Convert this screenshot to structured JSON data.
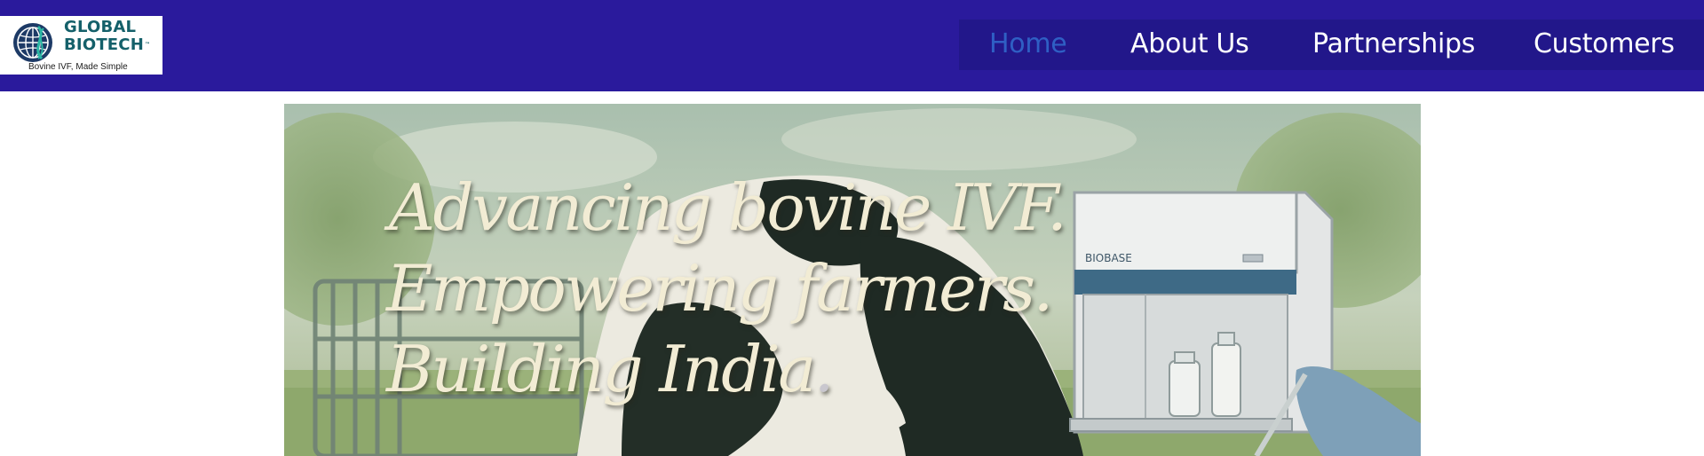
{
  "header": {
    "logo": {
      "name_line1": "GLOBAL",
      "name_line2": "BIOTECH",
      "trademark": "™",
      "tagline": "Bovine IVF, Made Simple",
      "icon": "dna-globe-icon"
    },
    "nav": {
      "items": [
        {
          "label": "Home",
          "active": true
        },
        {
          "label": "About Us",
          "active": false
        },
        {
          "label": "Partnerships",
          "active": false
        },
        {
          "label": "Customers",
          "active": false
        }
      ]
    }
  },
  "hero": {
    "line1": "Advancing bovine IVF.",
    "line2": "Empowering farmers.",
    "line3": "Building India",
    "line3_period": ".",
    "cabinet_label": "BIOBASE"
  },
  "colors": {
    "header_bg": "#2a1a9c",
    "nav_bg": "#22178a",
    "nav_active": "#2f5fc4",
    "nav_text": "#ffffff",
    "logo_text": "#14606a",
    "hero_text": "#f2ecd4"
  }
}
